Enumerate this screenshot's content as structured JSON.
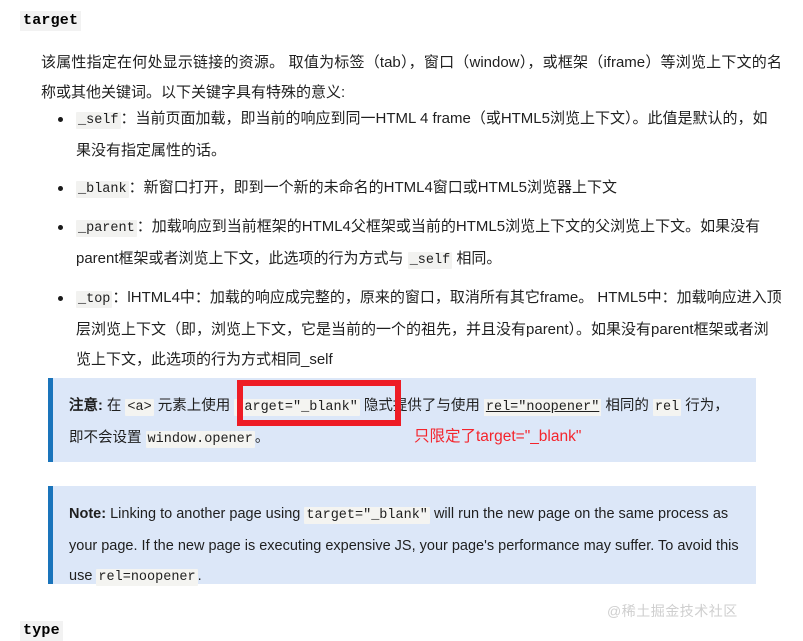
{
  "headings": {
    "target": "target",
    "type": "type"
  },
  "intro": {
    "text": "该属性指定在何处显示链接的资源。 取值为标签（tab），窗口（window），或框架（iframe）等浏览上下文的名称或其他关键词。以下关键字具有特殊的意义:"
  },
  "bullets": [
    {
      "keyword": "_self",
      "text": "：当前页面加载，即当前的响应到同一HTML 4 frame（或HTML5浏览上下文）。此值是默认的，如果没有指定属性的话。"
    },
    {
      "keyword": "_blank",
      "text": "：新窗口打开，即到一个新的未命名的HTML4窗口或HTML5浏览器上下文"
    },
    {
      "keyword": "_parent",
      "text_before": "：加载响应到当前框架的HTML4父框架或当前的HTML5浏览上下文的父浏览上下文。如果没有parent框架或者浏览上下文，此选项的行为方式与 ",
      "inline_code": "_self",
      "text_after": " 相同。"
    },
    {
      "keyword": "_top",
      "text": "：lHTML4中：加载的响应成完整的，原来的窗口，取消所有其它frame。 HTML5中：加载响应进入顶层浏览上下文（即，浏览上下文，它是当前的一个的祖先，并且没有parent）。如果没有parent框架或者浏览上下文，此选项的行为方式相同_self"
    }
  ],
  "note_cn": {
    "label": "注意:",
    "t1": " 在 ",
    "code_a": "<a>",
    "t2": " 元素上使用 ",
    "code_target": "target=\"_blank\"",
    "t3": " 隐式提供了与使用 ",
    "code_rel_link": "rel=\"noopener\"",
    "t4": " 相同的 ",
    "code_rel": "rel",
    "t5": " 行为，即不会设置 ",
    "code_opener": "window.opener",
    "t6": "。"
  },
  "note_en": {
    "label": "Note:",
    "t1": " Linking to another page using ",
    "code_target": "target=\"_blank\"",
    "t2": " will run the new page on the same process as your page. If the new page is executing expensive JS, your page's performance may suffer. To avoid this use ",
    "code_rel": "rel=noopener",
    "t3": "."
  },
  "annotation": {
    "red_text": "只限定了target=\"_blank\"",
    "red_color": "#f4242c"
  },
  "watermark": {
    "text": "@稀土掘金技术社区"
  },
  "colors": {
    "note_bg": "#dce7f8",
    "note_border": "#1a74bb",
    "code_bg": "#f2f2f0",
    "heading_bg": "#f2f2f2",
    "red": "#ee1c25"
  }
}
